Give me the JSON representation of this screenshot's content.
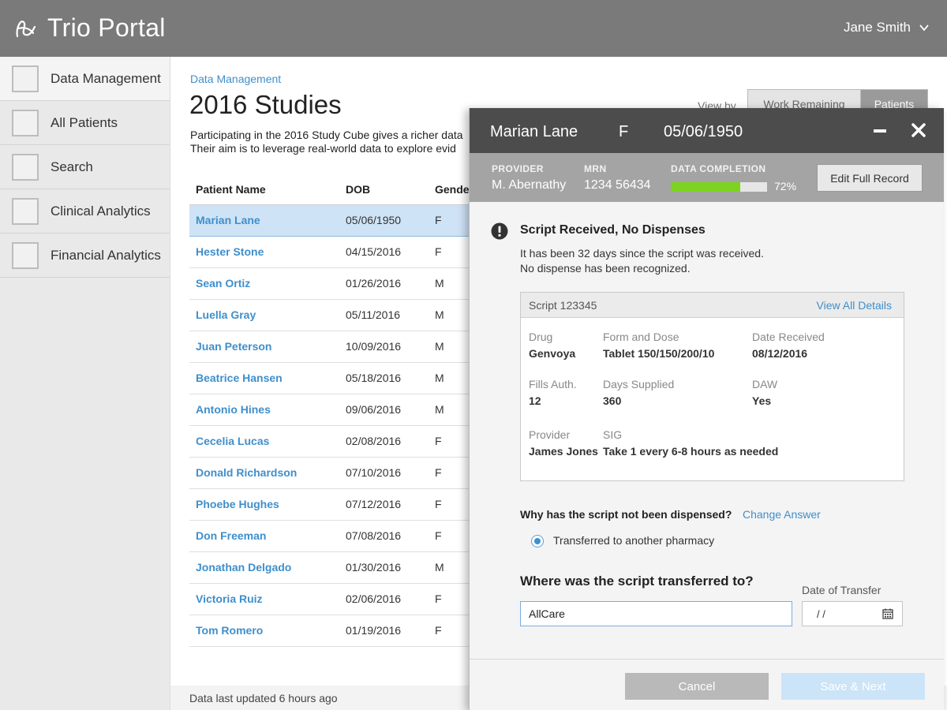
{
  "header": {
    "app_title": "Trio Portal",
    "user_name": "Jane Smith",
    "logo_icon": "trio-logo-icon"
  },
  "sidebar": {
    "items": [
      {
        "label": "Data Management",
        "active": true
      },
      {
        "label": "All Patients"
      },
      {
        "label": "Search"
      },
      {
        "label": "Clinical Analytics"
      },
      {
        "label": "Financial Analytics"
      }
    ]
  },
  "main": {
    "breadcrumb": "Data Management",
    "title": "2016 Studies",
    "description_line1": "Participating in the 2016 Study Cube gives a richer data",
    "description_line2": "Their aim is to leverage real-world data to explore evid",
    "view_by_label": "View by",
    "view_toggle": {
      "work_remaining": "Work Remaining",
      "patients": "Patients"
    },
    "table": {
      "headers": [
        "Patient Name",
        "DOB",
        "Gender"
      ],
      "rows": [
        {
          "name": "Marian Lane",
          "dob": "05/06/1950",
          "gender": "F"
        },
        {
          "name": "Hester Stone",
          "dob": "04/15/2016",
          "gender": "F"
        },
        {
          "name": "Sean Ortiz",
          "dob": "01/26/2016",
          "gender": "M"
        },
        {
          "name": "Luella Gray",
          "dob": "05/11/2016",
          "gender": "M"
        },
        {
          "name": "Juan Peterson",
          "dob": "10/09/2016",
          "gender": "M"
        },
        {
          "name": "Beatrice Hansen",
          "dob": "05/18/2016",
          "gender": "M"
        },
        {
          "name": "Antonio Hines",
          "dob": "09/06/2016",
          "gender": "M"
        },
        {
          "name": "Cecelia Lucas",
          "dob": "02/08/2016",
          "gender": "F"
        },
        {
          "name": "Donald Richardson",
          "dob": "07/10/2016",
          "gender": "F"
        },
        {
          "name": "Phoebe Hughes",
          "dob": "07/12/2016",
          "gender": "F"
        },
        {
          "name": "Don Freeman",
          "dob": "07/08/2016",
          "gender": "F"
        },
        {
          "name": "Jonathan Delgado",
          "dob": "01/30/2016",
          "gender": "M"
        },
        {
          "name": "Victoria Ruiz",
          "dob": "02/06/2016",
          "gender": "F"
        },
        {
          "name": "Tom Romero",
          "dob": "01/19/2016",
          "gender": "F"
        }
      ]
    },
    "footer": "Data last updated 6 hours ago"
  },
  "panel": {
    "patient_name": "Marian Lane",
    "gender": "F",
    "dob": "05/06/1950",
    "provider_label": "PROVIDER",
    "provider": "M. Abernathy",
    "mrn_label": "MRN",
    "mrn": "1234 56434",
    "completion_label": "DATA COMPLETION",
    "completion_percent": 72,
    "completion_text": "72%",
    "edit_button": "Edit Full Record",
    "alert": {
      "title": "Script Received, No Dispenses",
      "line1": "It has been 32 days since the script was received.",
      "line2": "No dispense has been recognized."
    },
    "script": {
      "title": "Script 123345",
      "link": "View All Details",
      "drug_label": "Drug",
      "drug": "Genvoya",
      "form_label": "Form and Dose",
      "form": "Tablet 150/150/200/10",
      "date_label": "Date Received",
      "date": "08/12/2016",
      "fills_label": "Fills Auth.",
      "fills": "12",
      "days_label": "Days Supplied",
      "days": "360",
      "daw_label": "DAW",
      "daw": "Yes",
      "provider_label": "Provider",
      "provider": "James Jones",
      "sig_label": "SIG",
      "sig": "Take 1 every 6-8 hours as needed"
    },
    "question1": "Why has the script not been dispensed?",
    "change_answer": "Change Answer",
    "answer": "Transferred to another pharmacy",
    "question2": "Where was the script transferred to?",
    "date_of_transfer_label": "Date of Transfer",
    "transfer_value": "AllCare",
    "date_value": " /  /",
    "cancel": "Cancel",
    "save": "Save & Next"
  },
  "colors": {
    "accent": "#3f8fcb",
    "progress": "#7dd321",
    "topbar": "#7a7a7a"
  }
}
